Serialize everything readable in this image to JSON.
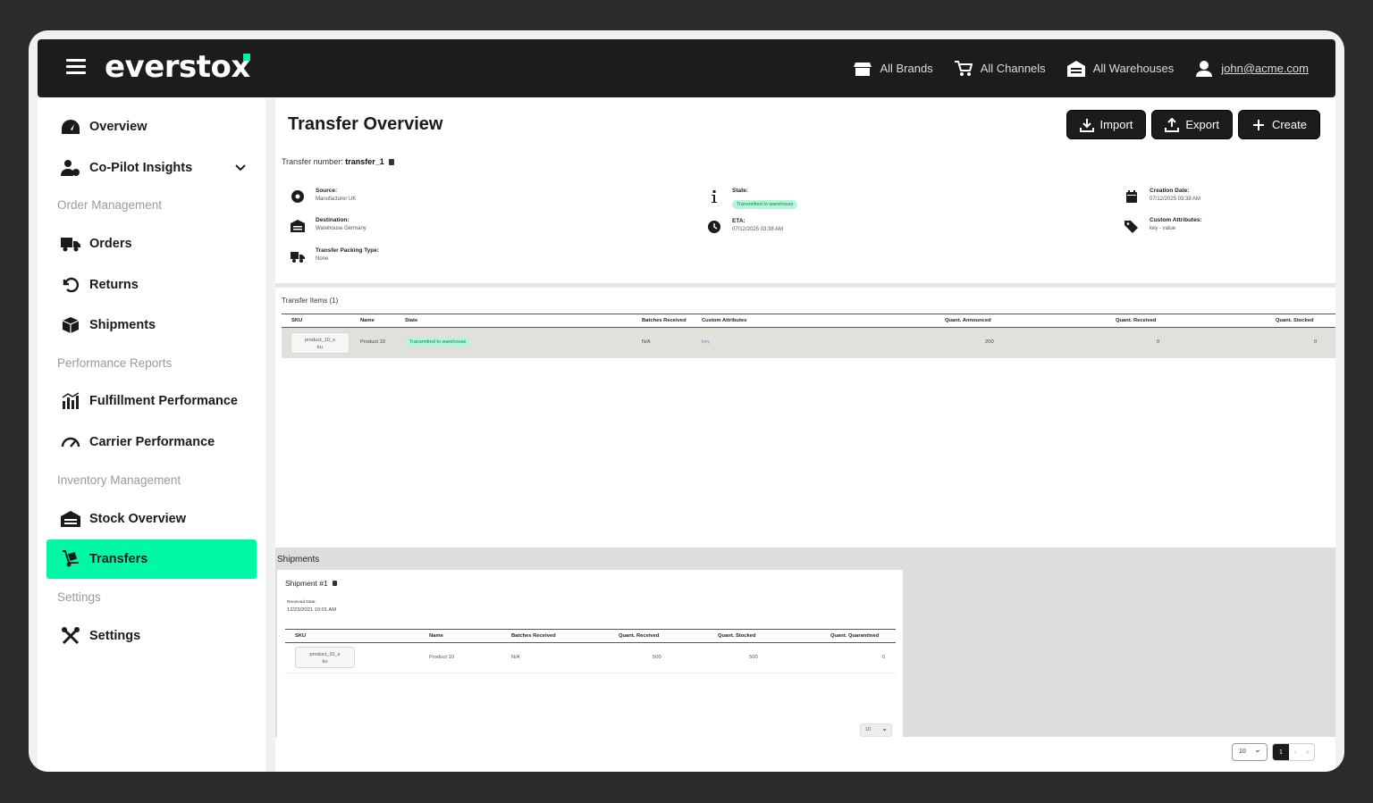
{
  "app": {
    "logo": "everstox"
  },
  "topnav": {
    "brands": "All Brands",
    "channels": "All Channels",
    "warehouses": "All Warehouses",
    "user": "john@acme.com"
  },
  "sidebar": {
    "overview": "Overview",
    "copilot": "Co-Pilot Insights",
    "section_order": "Order Management",
    "orders": "Orders",
    "returns": "Returns",
    "shipments": "Shipments",
    "section_perf": "Performance Reports",
    "fulfillment": "Fulfillment Performance",
    "carrier": "Carrier Performance",
    "section_inv": "Inventory Management",
    "stock": "Stock Overview",
    "transfers": "Transfers",
    "section_settings": "Settings",
    "settings": "Settings"
  },
  "page": {
    "title": "Transfer Overview",
    "import": "Import",
    "export": "Export",
    "create": "Create",
    "transfer_number_label": "Transfer number:",
    "transfer_number": "transfer_1"
  },
  "details": {
    "source_label": "Source:",
    "source": "Manufacturer UK",
    "destination_label": "Destination:",
    "destination": "Warehouse Germany",
    "packing_label": "Transfer Packing Type:",
    "packing": "None",
    "state_label": "State:",
    "state": "Transmitted to warehouse",
    "eta_label": "ETA:",
    "eta": "07/12/2025 03:38 AM",
    "creation_label": "Creation Date:",
    "creation": "07/12/2025 03:38 AM",
    "custom_label": "Custom Attributes:",
    "custom": "key - value"
  },
  "items": {
    "title": "Transfer Items (1)",
    "headers": {
      "sku": "SKU",
      "name": "Name",
      "state": "State",
      "batches": "Batches Received",
      "custom": "Custom Attributes",
      "announced": "Quant. Announced",
      "received": "Quant. Received",
      "stocked": "Quant. Stocked"
    },
    "row": {
      "sku_line1": "product_10_s",
      "sku_line2": "ku",
      "name": "Product 10",
      "state": "Transmitted to warehouse",
      "batches": "N/A",
      "custom": "key",
      "announced": "200",
      "received": "0",
      "stocked": "0"
    }
  },
  "shipments": {
    "title": "Shipments",
    "card_title": "Shipment #1",
    "received_label": "Received Date:",
    "received": "12/23/2021 10:01 AM",
    "headers": {
      "sku": "SKU",
      "name": "Name",
      "batches": "Batches Received",
      "received": "Quant. Received",
      "stocked": "Quant. Stocked",
      "quarantined": "Quant. Quarantined"
    },
    "row": {
      "sku_line1": "product_10_s",
      "sku_line2": "ku",
      "name": "Product 10",
      "batches": "N/A",
      "received": "500",
      "stocked": "500",
      "quarantined": "0"
    },
    "page_size": "10"
  },
  "pager": {
    "page_size": "10",
    "current": "1",
    "next": "›",
    "last": "»"
  },
  "colors": {
    "accent": "#00f7a6",
    "dark": "#1c1c1c"
  }
}
